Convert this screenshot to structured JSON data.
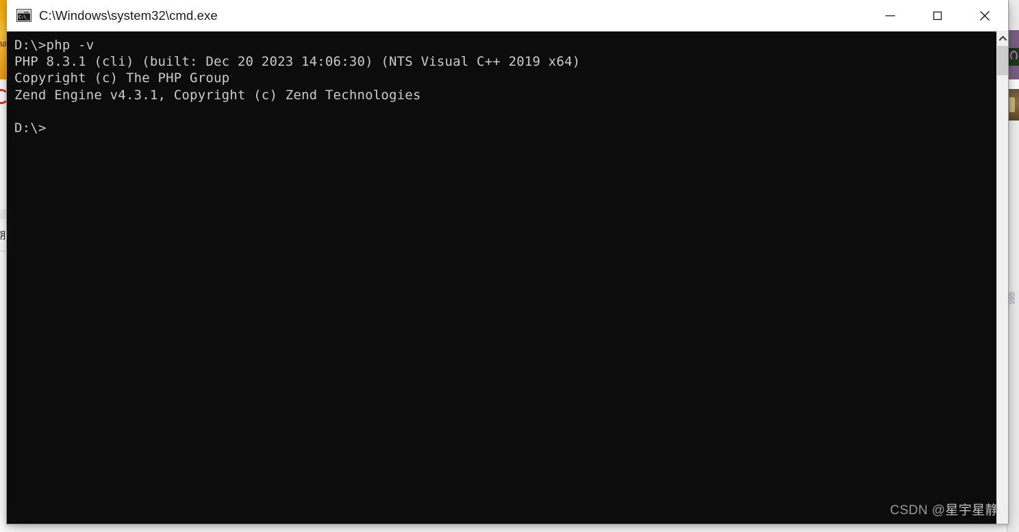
{
  "window": {
    "title": "C:\\Windows\\system32\\cmd.exe",
    "icon": "cmd-icon",
    "icon_glyph": "C:\\_",
    "controls": {
      "minimize_label": "Minimize",
      "maximize_label": "Maximize",
      "close_label": "Close"
    }
  },
  "terminal": {
    "background_color": "#0c0c0c",
    "text_color": "#cccccc",
    "lines": [
      "D:\\>php -v",
      "PHP 8.3.1 (cli) (built: Dec 20 2023 14:06:30) (NTS Visual C++ 2019 x64)",
      "Copyright (c) The PHP Group",
      "Zend Engine v4.3.1, Copyright (c) Zend Technologies",
      "",
      "D:\\>"
    ],
    "content": "D:\\>php -v\nPHP 8.3.1 (cli) (built: Dec 20 2023 14:06:30) (NTS Visual C++ 2019 x64)\nCopyright (c) The PHP Group\nZend Engine v4.3.1, Copyright (c) Zend Technologies\n\nD:\\>",
    "command": "php -v",
    "prompt": "D:\\>",
    "php_version": "8.3.1",
    "php_sapi": "cli",
    "php_build_date": "Dec 20 2023 14:06:30",
    "php_build_info": "NTS Visual C++ 2019 x64",
    "php_copyright": "Copyright (c) The PHP Group",
    "zend_engine_version": "v4.3.1",
    "zend_copyright": "Copyright (c) Zend Technologies"
  },
  "scrollbar": {
    "up_arrow": "chevron-up-icon",
    "thumb_color": "#cdcdcd",
    "track_color": "#f0f0f0"
  },
  "watermark": {
    "prefix": "CSDN @",
    "author": "星宇星静",
    "full": "CSDN @星宇星静"
  },
  "background": {
    "left_banner_text": "na",
    "left_cjk_text": "期刻",
    "accent_orange": "#f0a500",
    "accent_red": "#d93025"
  }
}
